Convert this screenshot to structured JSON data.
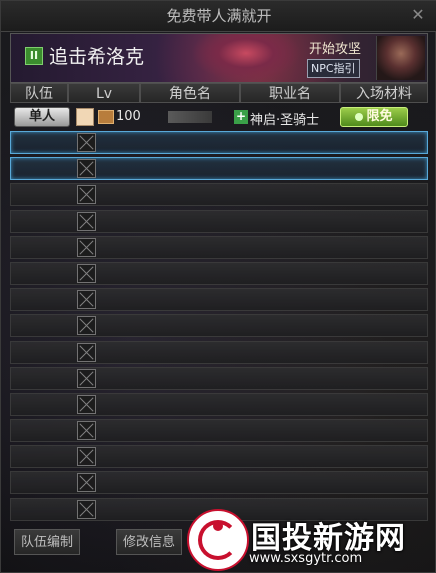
{
  "window": {
    "title": "免费带人满就开",
    "close_glyph": "✕"
  },
  "banner": {
    "toggle_glyph": "II",
    "quest_title": "追击希洛克",
    "start_strategy": "开始攻坚",
    "npc_guide": "NPC指引"
  },
  "table": {
    "headers": [
      "队伍",
      "Lv",
      "角色名",
      "职业名",
      "入场材料"
    ],
    "self_row": {
      "party_label": "单人",
      "level": "100",
      "class_name": "神启·圣骑士",
      "entry_status": "限免"
    },
    "empty_slots": 15
  },
  "buttons": {
    "party_edit": "队伍编制",
    "modify_info": "修改信息"
  },
  "watermark": {
    "text": "国投新游网",
    "url": "www.sxsgytr.com"
  },
  "colors": {
    "selected_border": "#5fb6e8",
    "free_badge": "#6fa32c",
    "watermark_red": "#c8102e"
  }
}
